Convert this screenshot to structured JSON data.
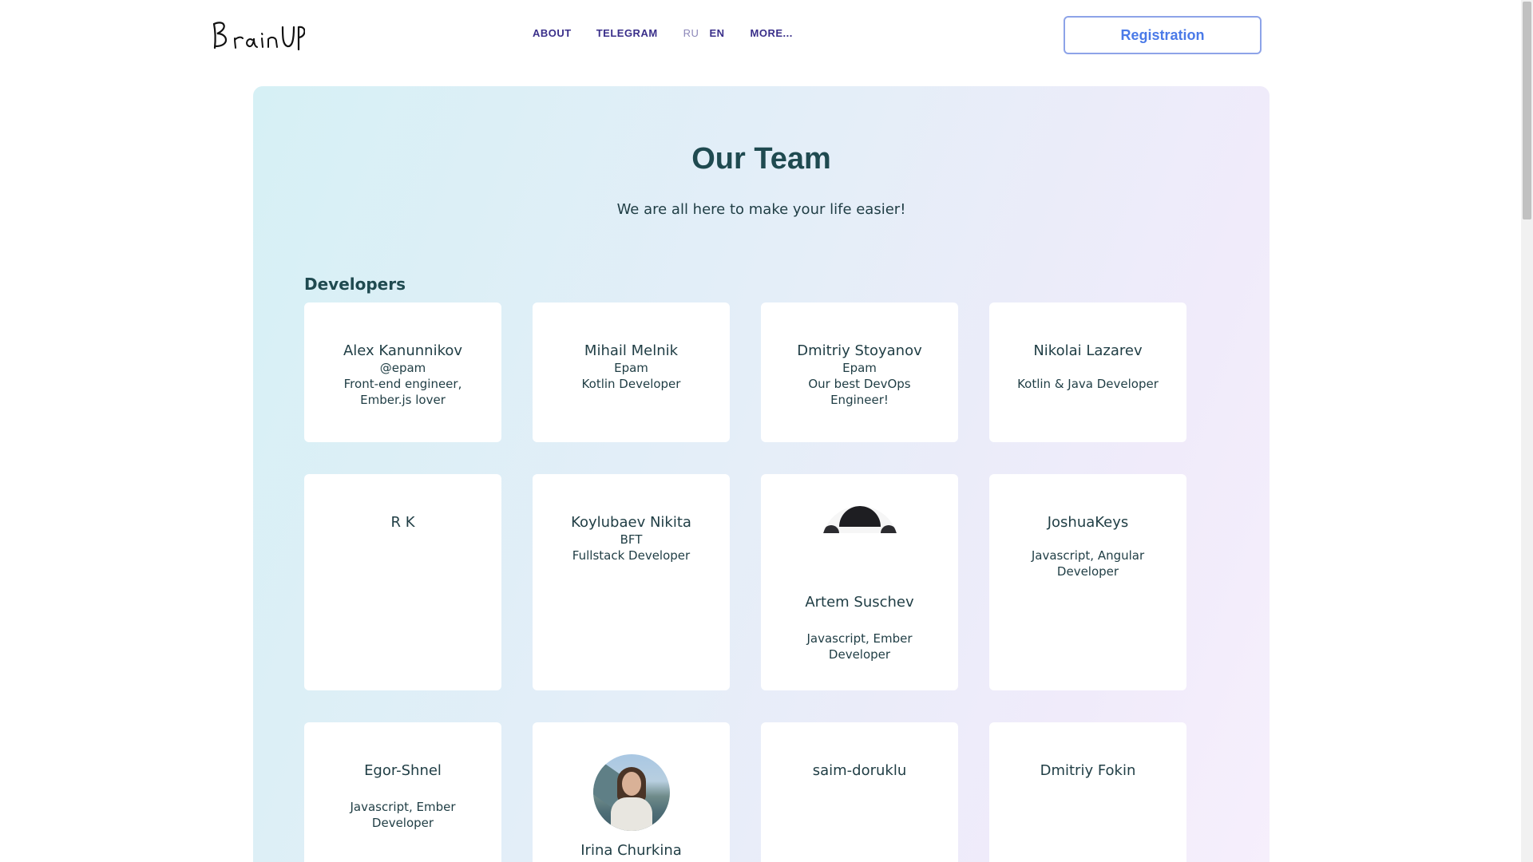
{
  "header": {
    "logo_text": "BrainUP",
    "nav": {
      "about": "ABOUT",
      "telegram": "TELEGRAM",
      "lang_ru": "RU",
      "lang_en": "EN",
      "more": "MORE..."
    },
    "registration_label": "Registration"
  },
  "main": {
    "title": "Our Team",
    "subtitle": "We are all here to make your life easier!",
    "section_title": "Developers",
    "members": [
      {
        "name": "Alex Kanunnikov",
        "lines": [
          "@epam",
          "Front-end engineer,",
          "Ember.js lover"
        ]
      },
      {
        "name": "Mihail Melnik",
        "lines": [
          "Epam",
          "Kotlin Developer"
        ]
      },
      {
        "name": "Dmitriy Stoyanov",
        "lines": [
          "Epam",
          "Our best DevOps",
          "Engineer!"
        ]
      },
      {
        "name": "Nikolai Lazarev",
        "lines": [
          "",
          "Kotlin & Java Developer"
        ]
      },
      {
        "name": "R K",
        "lines": []
      },
      {
        "name": "Koylubaev Nikita",
        "lines": [
          "BFT",
          "Fullstack Developer"
        ]
      },
      {
        "name": "Artem Suschev",
        "lines": [
          "",
          "Javascript, Ember",
          "Developer"
        ],
        "avatar": "partial-photo"
      },
      {
        "name": "JoshuaKeys",
        "lines": [
          "",
          "Javascript, Angular",
          "Developer"
        ]
      },
      {
        "name": "Egor-Shnel",
        "lines": [
          "",
          "Javascript, Ember",
          "Developer"
        ]
      },
      {
        "name": "Irina Churkina",
        "lines": [],
        "avatar": "photo"
      },
      {
        "name": "saim-doruklu",
        "lines": []
      },
      {
        "name": "Dmitriy Fokin",
        "lines": []
      }
    ]
  },
  "colors": {
    "nav_text": "#3a2f8a",
    "registration_accent": "#4a7ae8",
    "heading": "#1f4a50"
  }
}
